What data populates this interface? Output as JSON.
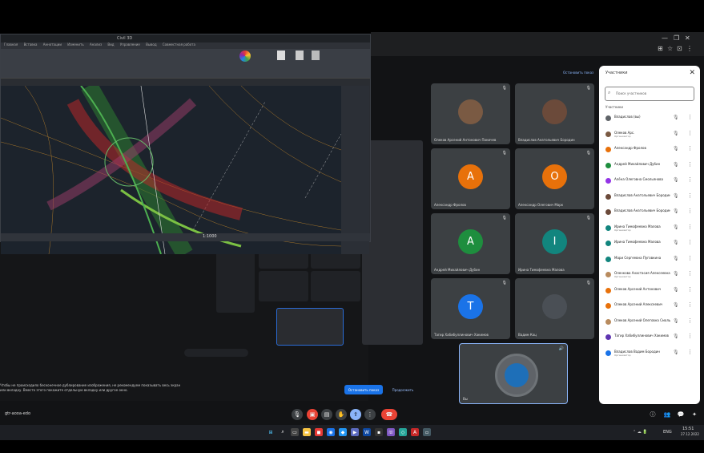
{
  "meet": {
    "notice_text": "Чтобы не происходило бесконечное дублирование изображения, не рекомендуем показывать весь экран или вкладку. Вместо этого покажите отдельную вкладку или другое окно.",
    "stop_button": "Остановить показ",
    "continue_button": "Продолжить",
    "top_link": "Остановить показ",
    "meeting_code": "gtr-aooa-edo",
    "self_name": "Вы"
  },
  "cad": {
    "title": "Civil 3D",
    "menu": [
      "Главная",
      "Вставка",
      "Аннотации",
      "Изменить",
      "Анализ",
      "Вид",
      "Управление",
      "Вывод",
      "Совместная работа"
    ],
    "status_scale": "1:1000"
  },
  "tiles": [
    {
      "name": "Олеков Арсений Антонович Паничев",
      "initial": "",
      "color": "#7a5a43",
      "photo": true
    },
    {
      "name": "Владислав Анатольевич Бородин",
      "initial": "",
      "color": "#6b4a3a",
      "photo": true
    },
    {
      "name": "Александр Фролов",
      "initial": "А",
      "color": "#e8710a",
      "photo": false
    },
    {
      "name": "Александр Олегович Марк",
      "initial": "О",
      "color": "#e8710a",
      "photo": false
    },
    {
      "name": "Андрей Михайлович Дубин",
      "initial": "А",
      "color": "#1e8e3e",
      "photo": false
    },
    {
      "name": "Ирина Тимофеевна Малова",
      "initial": "І",
      "color": "#12857e",
      "photo": false
    },
    {
      "name": "Тагир Хабибуллинович Хакимов",
      "initial": "Т",
      "color": "#1a73e8",
      "photo": false
    },
    {
      "name": "Вадим Коц",
      "initial": "",
      "color": "#4a4f55",
      "photo": true
    }
  ],
  "sidebar": {
    "title": "Участники",
    "search_placeholder": "Поиск участников",
    "section": "Участники",
    "participants": [
      {
        "name": "Владислав (вы)",
        "sub": "",
        "color": "#5f6368"
      },
      {
        "name": "Олеков Арс.",
        "sub": "Организатор",
        "color": "#7a5a43"
      },
      {
        "name": "Александр Фролов",
        "sub": "",
        "color": "#e8710a"
      },
      {
        "name": "Андрей Михайлович Дубин",
        "sub": "",
        "color": "#1e8e3e"
      },
      {
        "name": "Алёна Олеговна Смольянова",
        "sub": "",
        "color": "#9334e6"
      },
      {
        "name": "Владислав Анатольевич Бородин",
        "sub": "",
        "color": "#6b4a3a"
      },
      {
        "name": "Владислав Анатольевич Бородин",
        "sub": "",
        "color": "#6b4a3a"
      },
      {
        "name": "Ирина Тимофеевна Малова",
        "sub": "Организатор",
        "color": "#12857e"
      },
      {
        "name": "Ирина Тимофеевна Малова",
        "sub": "",
        "color": "#12857e"
      },
      {
        "name": "Мари Сергеевна Пуговкина",
        "sub": "",
        "color": "#12857e"
      },
      {
        "name": "Оленкова Анастасия Алексеевна",
        "sub": "Организатор",
        "color": "#b88b5e"
      },
      {
        "name": "Олеков Арсений Антонович",
        "sub": "",
        "color": "#e8710a"
      },
      {
        "name": "Олеков Арсений Алексеевич",
        "sub": "",
        "color": "#e8710a"
      },
      {
        "name": "Олеков Арсений Олеговна Смольн",
        "sub": "",
        "color": "#b88b5e"
      },
      {
        "name": "Тагир Хабибуллинович Хакимов",
        "sub": "",
        "color": "#5e35b1"
      },
      {
        "name": "Владислав Вадим Бородин",
        "sub": "Организатор",
        "color": "#1a73e8"
      }
    ]
  },
  "taskbar": {
    "lang": "ENG",
    "time": "15:51",
    "date": "27.12.2022"
  }
}
